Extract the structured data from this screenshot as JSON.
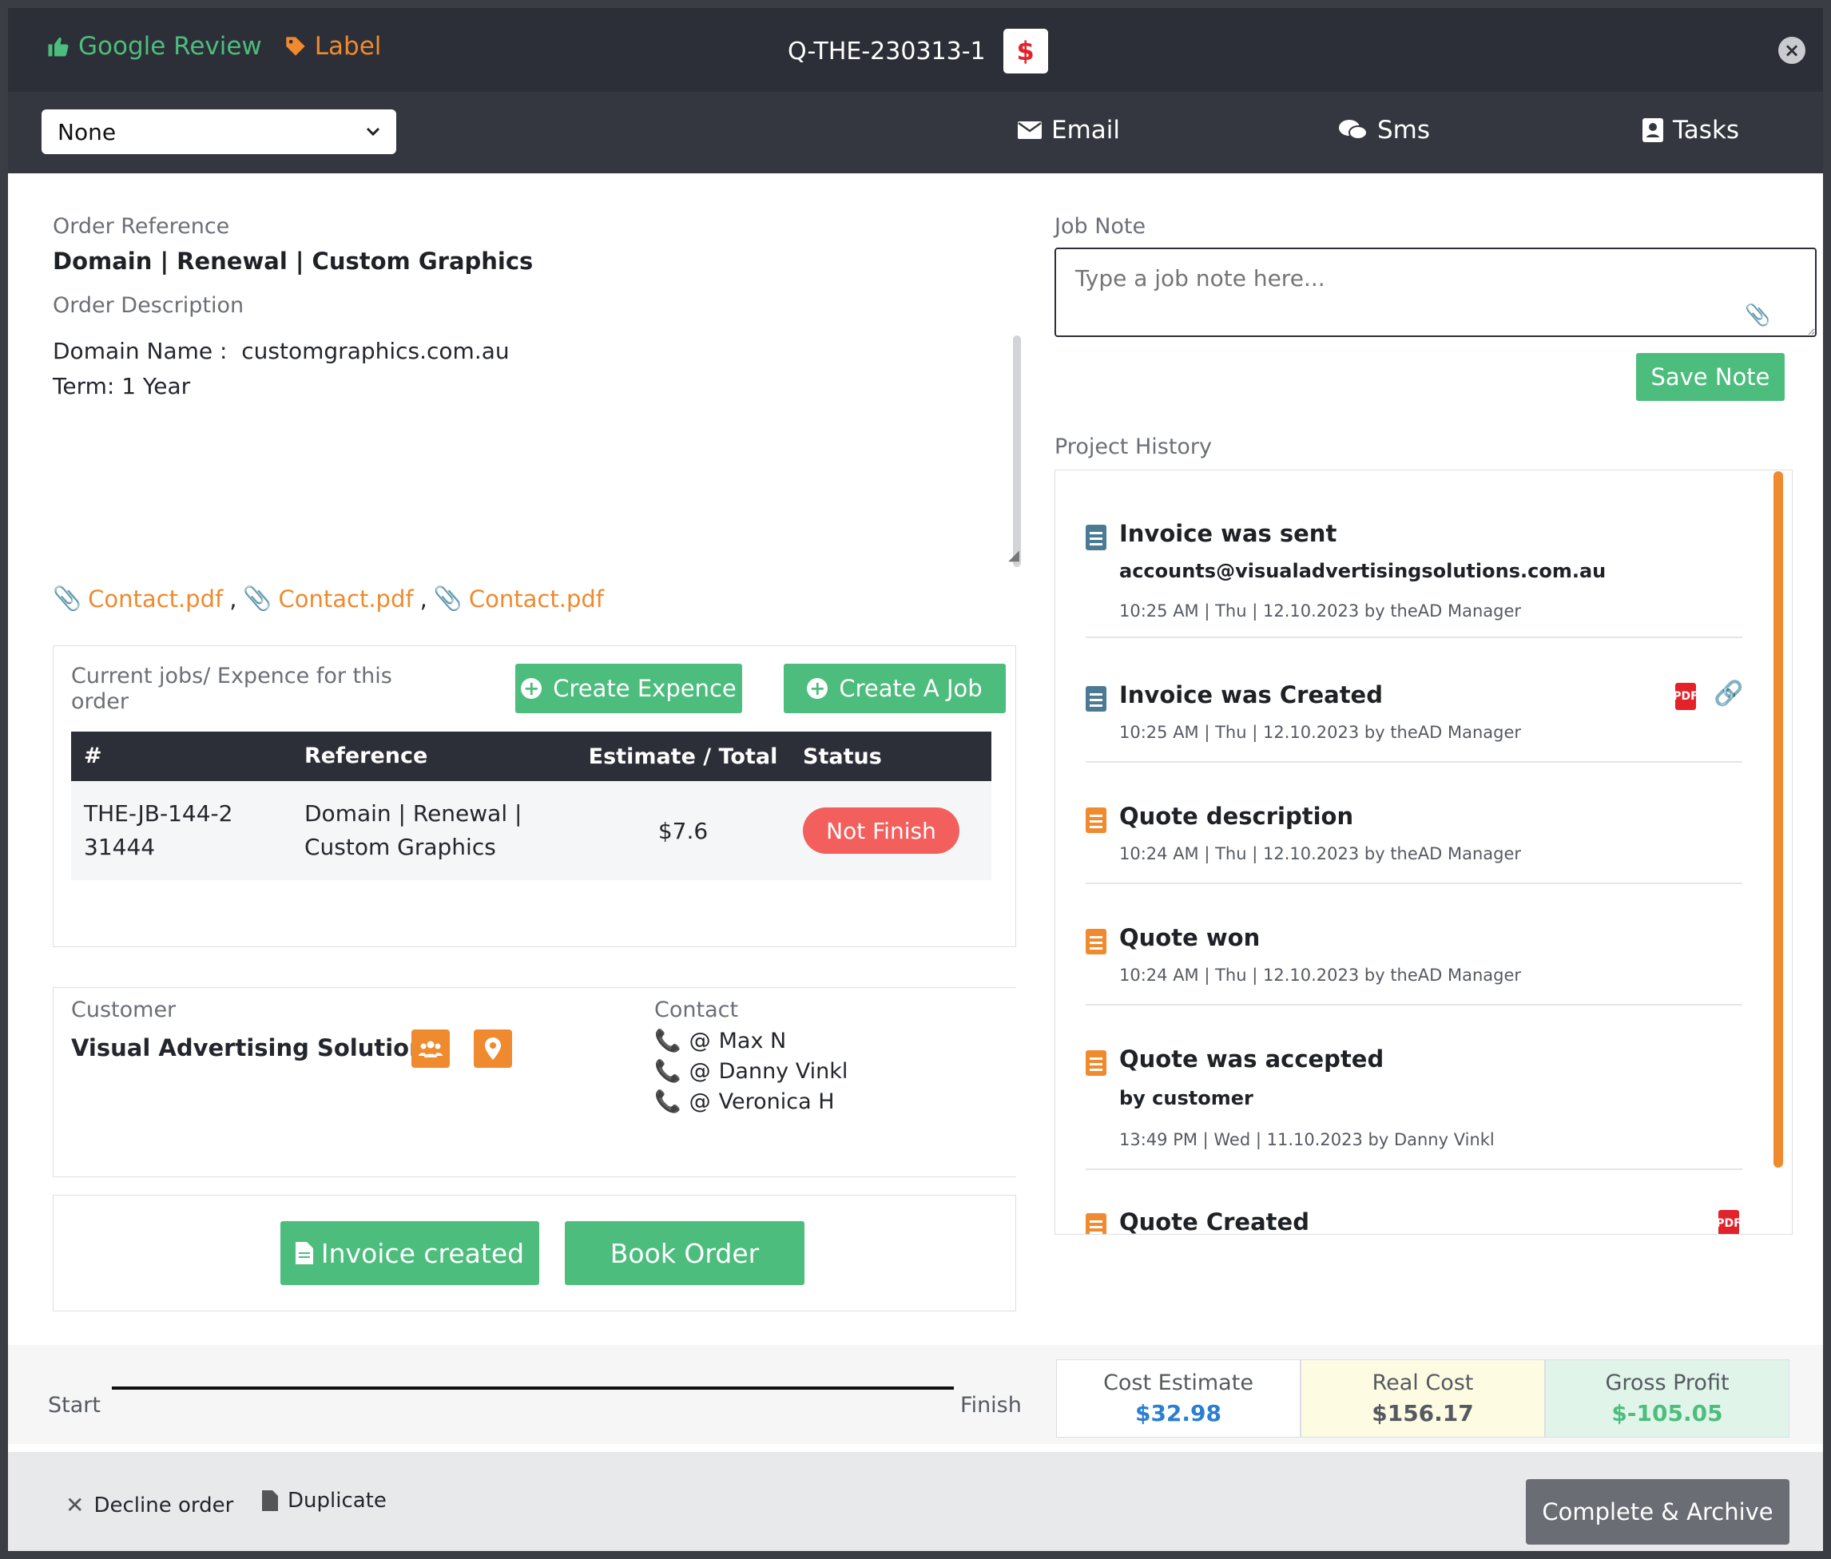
{
  "header": {
    "google_review": "Google Review",
    "label": "Label",
    "order_id": "Q-THE-230313-1",
    "dollar_symbol": "$",
    "close_symbol": "×"
  },
  "nav": {
    "select_value": "None",
    "email": "Email",
    "sms": "Sms",
    "tasks": "Tasks"
  },
  "order": {
    "reference_label": "Order Reference",
    "reference_value": "Domain | Renewal | Custom Graphics",
    "description_label": "Order Description",
    "description_line1": "Domain Name :  customgraphics.com.au",
    "description_line2": "Term: 1 Year",
    "attachments": [
      "Contact.pdf",
      "Contact.pdf",
      "Contact.pdf"
    ],
    "attachment_separator": ","
  },
  "jobs": {
    "title": "Current jobs/ Expence for this order",
    "create_expence": "Create Expence",
    "create_job": "Create A Job",
    "columns": [
      "#",
      "Reference",
      "Estimate / Total",
      "Status"
    ],
    "rows": [
      {
        "id": "THE-JB-144-231444",
        "reference": "Domain | Renewal | Custom Graphics",
        "total": "$7.6",
        "status": "Not Finish"
      }
    ]
  },
  "customer": {
    "label": "Customer",
    "name": "Visual Advertising Solutions",
    "contact_label": "Contact",
    "at_symbol": "@",
    "contacts": [
      "Max N",
      "Danny Vinkl",
      "Veronica H"
    ]
  },
  "actions": {
    "invoice_created": "Invoice created",
    "book_order": "Book Order"
  },
  "job_note": {
    "label": "Job Note",
    "placeholder": "Type a job note here...",
    "save": "Save Note"
  },
  "history": {
    "label": "Project History",
    "items": [
      {
        "title": "Invoice was sent",
        "sub": "accounts@visualadvertisingsolutions.com.au",
        "meta": "10:25 AM | Thu | 12.10.2023 by theAD Manager"
      },
      {
        "title": "Invoice was Created",
        "sub": "",
        "meta": "10:25 AM | Thu | 12.10.2023 by theAD Manager"
      },
      {
        "title": "Quote description",
        "sub": "",
        "meta": "10:24 AM | Thu | 12.10.2023 by theAD Manager"
      },
      {
        "title": "Quote won",
        "sub": "",
        "meta": "10:24 AM | Thu | 12.10.2023 by theAD Manager"
      },
      {
        "title": "Quote was accepted",
        "sub": "by customer",
        "meta": "13:49 PM | Wed | 11.10.2023 by Danny Vinkl"
      },
      {
        "title": "Quote Created",
        "sub": "",
        "meta": ""
      }
    ]
  },
  "progress": {
    "start": "Start",
    "finish": "Finish"
  },
  "costs": {
    "estimate_label": "Cost Estimate",
    "estimate_value": "$32.98",
    "estimate_color": "#2b7fd1",
    "real_label": "Real Cost",
    "real_value": "$156.17",
    "real_color": "#555a61",
    "profit_label": "Gross Profit",
    "profit_value": "$-105.05",
    "profit_color": "#4dbd7d"
  },
  "footer": {
    "decline": "Decline order",
    "duplicate": "Duplicate",
    "complete": "Complete & Archive"
  }
}
